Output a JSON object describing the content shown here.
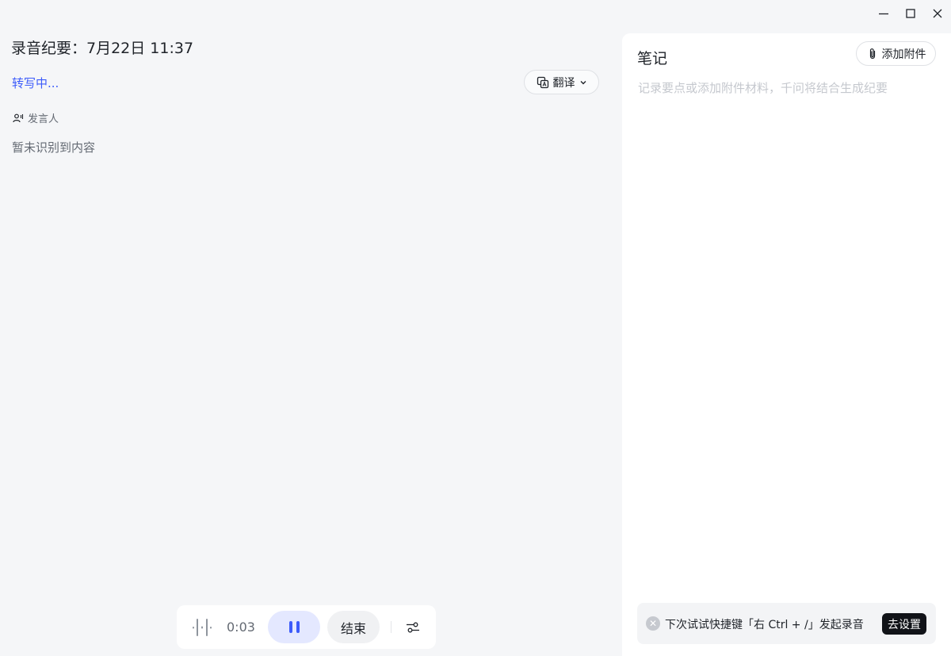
{
  "window": {
    "minimize_icon": "minimize-icon",
    "maximize_icon": "maximize-icon",
    "close_icon": "close-icon"
  },
  "transcript": {
    "title": "录音纪要：7月22日 11:37",
    "status": "转写中...",
    "translate_label": "翻译",
    "speaker_label": "发言人",
    "empty_text": "暂未识别到内容"
  },
  "recorder": {
    "elapsed": "0:03",
    "end_label": "结束",
    "accent": "#3c5bfa"
  },
  "notes": {
    "title": "笔记",
    "attach_label": "添加附件",
    "placeholder": "记录要点或添加附件材料，千问将结合生成纪要",
    "value": ""
  },
  "tip": {
    "text": "下次试试快捷键「右 Ctrl + /」发起录音",
    "action_label": "去设置"
  }
}
